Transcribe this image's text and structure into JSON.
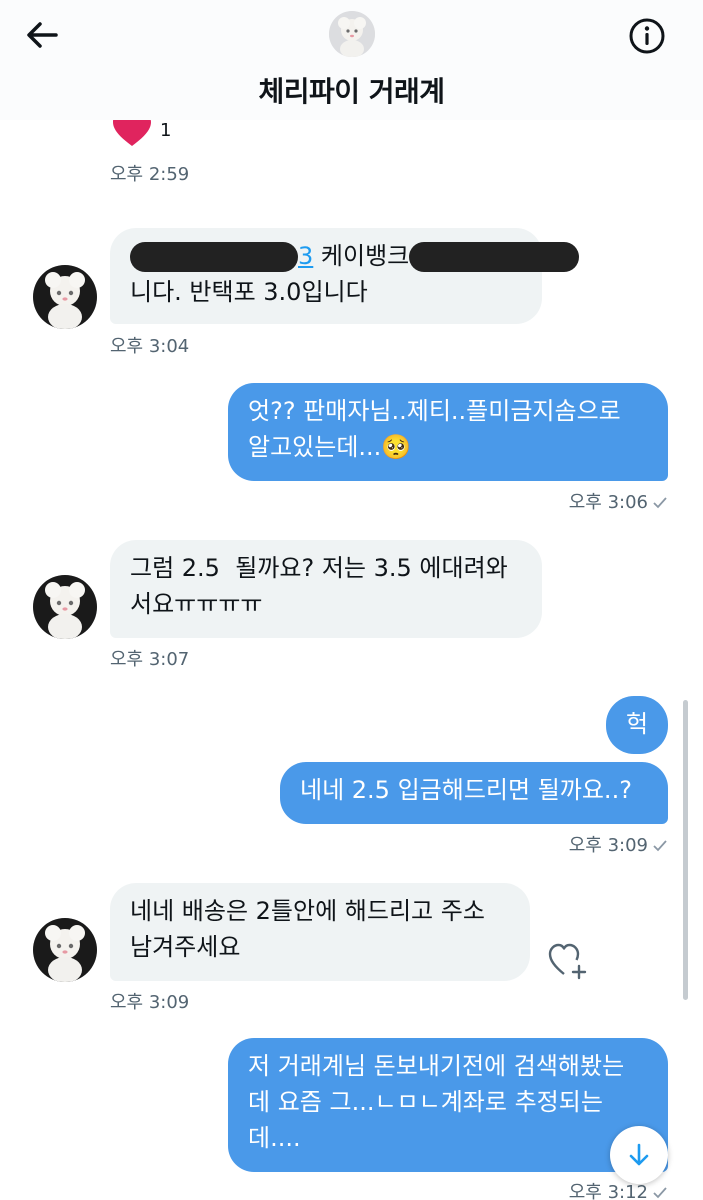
{
  "header": {
    "title": "체리파이 거래계"
  },
  "reaction": {
    "count": "1"
  },
  "messages": [
    {
      "time": "오후 2:59"
    },
    {
      "line1_visible_end": "3",
      "line1_text": " 케이뱅크",
      "line2": "니다. 반택포 3.0입니다",
      "time": "오후 3:04"
    },
    {
      "line1": "엇?? 판매자님..제티..플미금지솜으로",
      "line2": "알고있는데...🥺",
      "time": "오후 3:06"
    },
    {
      "line1": "그럼 2.5  될까요? 저는 3.5 에대려와",
      "line2": "서요ㅠㅠㅠㅠ",
      "time": "오후 3:07"
    },
    {
      "line1": "헉"
    },
    {
      "line1": "네네 2.5 입금해드리면 될까요..?",
      "time": "오후 3:09"
    },
    {
      "line1": "네네 배송은 2틀안에 해드리고 주소",
      "line2": "남겨주세요",
      "time": "오후 3:09"
    },
    {
      "line1": "저 거래계님 돈보내기전에 검색해봤는",
      "line2": "데 요즘 그...ㄴㅁㄴ계좌로 추정되는",
      "line3": "데....",
      "time": "오후 3:12"
    }
  ],
  "icons": {
    "back": "arrow-left-icon",
    "info": "info-icon",
    "heart": "heart-icon",
    "like": "heart-plus-icon",
    "check": "check-icon",
    "scroll": "arrow-down-icon"
  },
  "colors": {
    "outgoing_bubble": "#4a99e9",
    "incoming_bubble": "#eff3f4",
    "timestamp": "#536471",
    "heart": "#e0245e"
  }
}
